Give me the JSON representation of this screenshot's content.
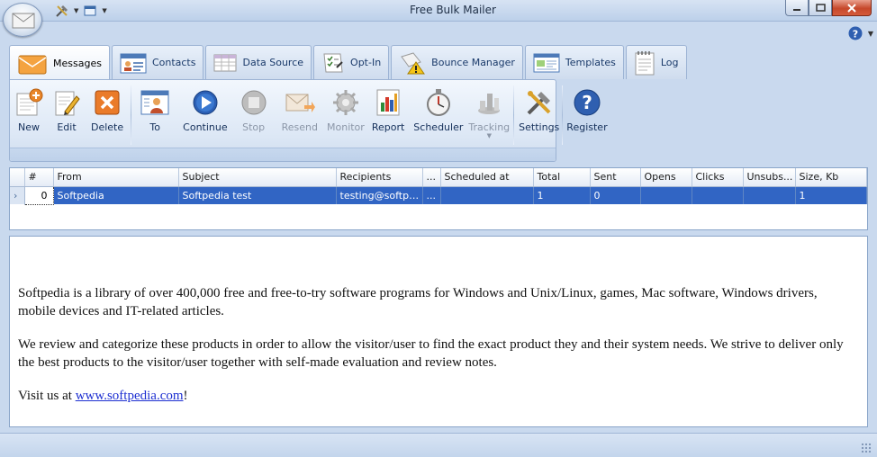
{
  "window": {
    "title": "Free Bulk Mailer"
  },
  "tabs": [
    {
      "label": "Messages",
      "icon": "envelope-icon",
      "active": true
    },
    {
      "label": "Contacts",
      "icon": "contacts-card-icon",
      "active": false
    },
    {
      "label": "Data Source",
      "icon": "spreadsheet-icon",
      "active": false
    },
    {
      "label": "Opt-In",
      "icon": "checklist-icon",
      "active": false
    },
    {
      "label": "Bounce Manager",
      "icon": "bounce-warning-icon",
      "active": false
    },
    {
      "label": "Templates",
      "icon": "template-icon",
      "active": false
    },
    {
      "label": "Log",
      "icon": "log-notepad-icon",
      "active": false
    }
  ],
  "ribbon": {
    "new": "New",
    "edit": "Edit",
    "delete": "Delete",
    "to": "To",
    "continue": "Continue",
    "stop": "Stop",
    "resend": "Resend",
    "monitor": "Monitor",
    "report": "Report",
    "scheduler": "Scheduler",
    "tracking": "Tracking",
    "settings": "Settings",
    "register": "Register"
  },
  "grid": {
    "columns": [
      "#",
      "From",
      "Subject",
      "Recipients",
      "...",
      "Scheduled at",
      "Total",
      "Sent",
      "Opens",
      "Clicks",
      "Unsubs...",
      "Size, Kb"
    ],
    "rows": [
      {
        "num": "0",
        "from": "Softpedia",
        "subject": "Softpedia test",
        "recipients": "testing@softpe...",
        "more": "...",
        "scheduled": "",
        "total": "1",
        "sent": "0",
        "opens": "",
        "clicks": "",
        "unsubs": "",
        "size": "1"
      }
    ]
  },
  "preview": {
    "p1": "Softpedia is a library of over 400,000 free and free-to-try software programs for Windows and Unix/Linux, games, Mac software, Windows drivers, mobile devices and IT-related articles.",
    "p2": "We review and categorize these products in order to allow the visitor/user to find the exact product they and their system needs. We strive to deliver only the best products to the visitor/user together with self-made evaluation and review notes.",
    "p3_prefix": "Visit us at ",
    "p3_link": "www.softpedia.com",
    "p3_suffix": "!"
  },
  "colors": {
    "selection": "#3165c4",
    "link": "#1d2fd1",
    "frame": "#c9d9ee"
  }
}
